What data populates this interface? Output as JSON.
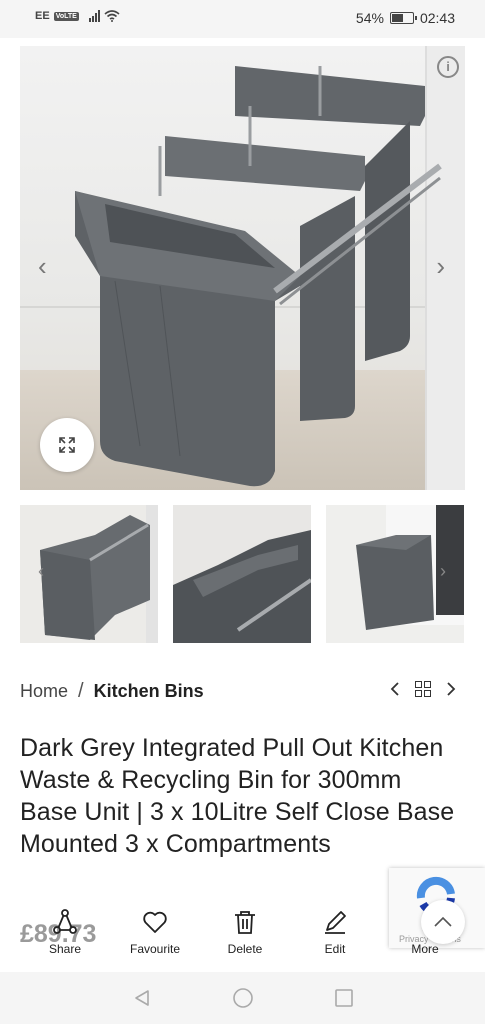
{
  "status_bar": {
    "carrier": "EE",
    "volte": "VoLTE",
    "battery_text": "54%",
    "battery_level": 0.54,
    "time": "02:43"
  },
  "gallery": {
    "info_icon": "i"
  },
  "breadcrumb": {
    "home": "Home",
    "separator": "/",
    "current": "Kitchen Bins"
  },
  "product": {
    "title": "Dark Grey Integrated Pull Out Kitchen Waste & Recycling Bin for 300mm Base Unit | 3 x 10Litre Self Close Base Mounted 3 x Compartments",
    "price": "£89.73"
  },
  "actions": [
    {
      "label": "Share",
      "icon": "share-icon"
    },
    {
      "label": "Favourite",
      "icon": "heart-icon"
    },
    {
      "label": "Delete",
      "icon": "trash-icon"
    },
    {
      "label": "Edit",
      "icon": "pencil-icon"
    },
    {
      "label": "More",
      "icon": "more-icon"
    }
  ],
  "recaptcha": {
    "text": "Privacy - Terms"
  },
  "colors": {
    "accent": "#222222",
    "bin_grey": "#5b5f63"
  }
}
